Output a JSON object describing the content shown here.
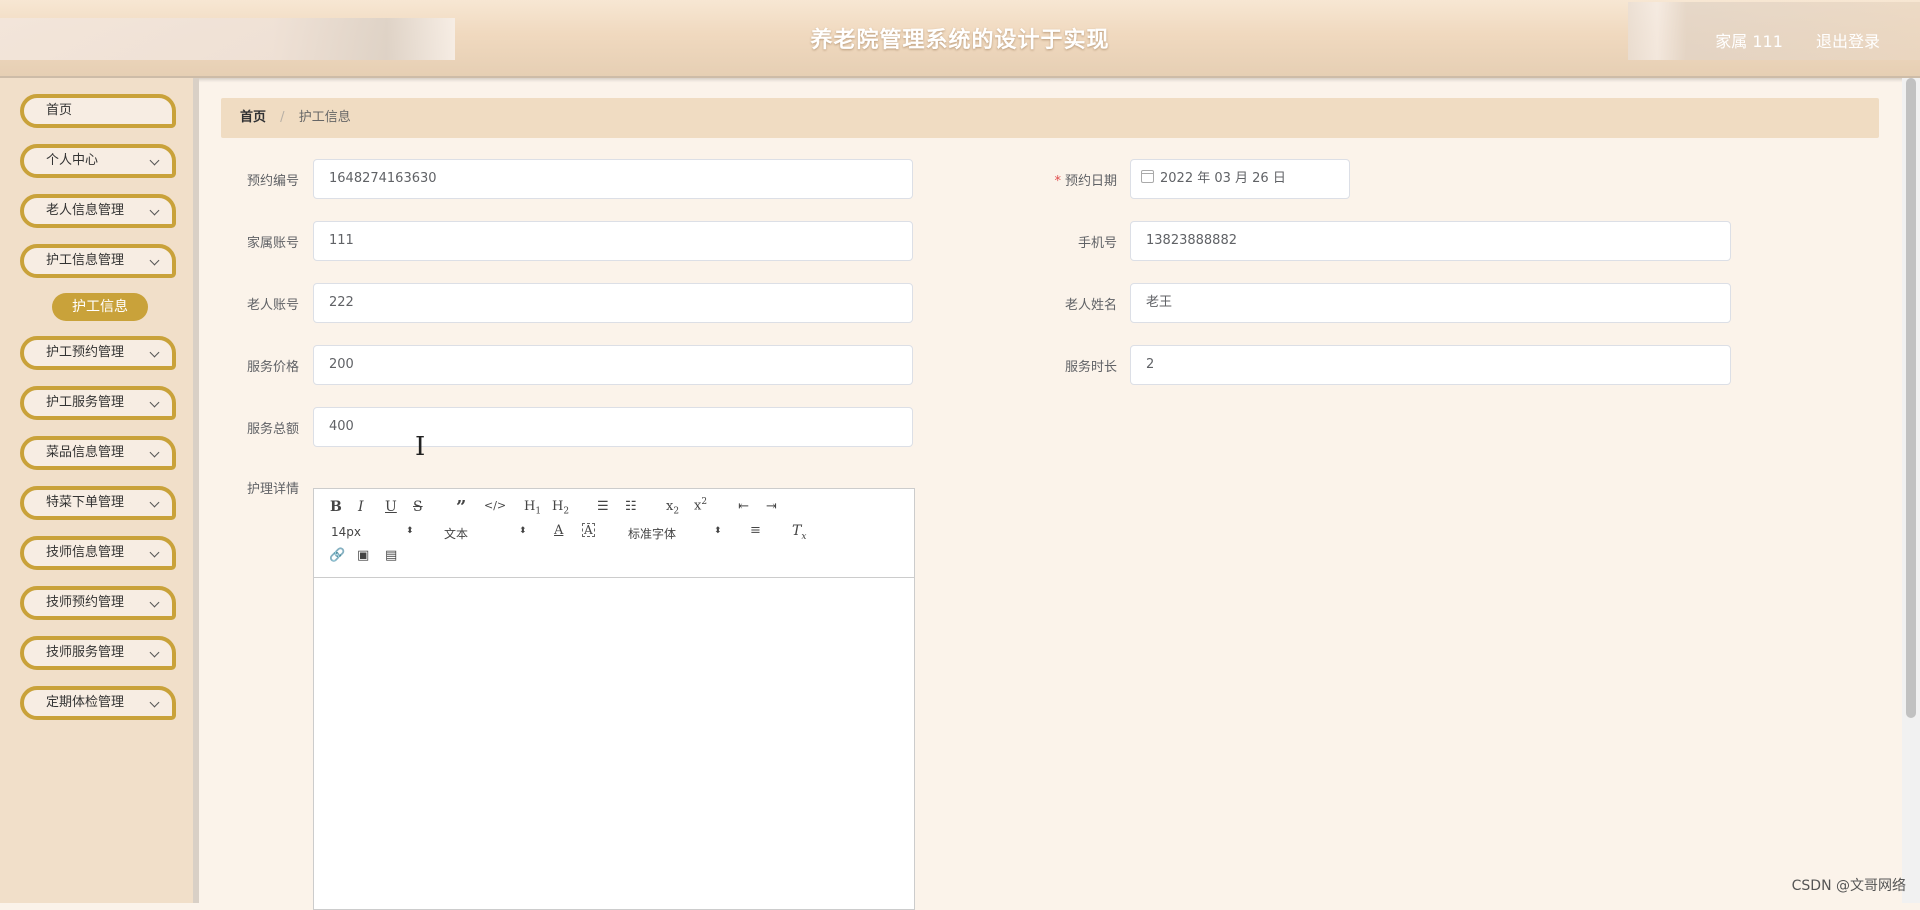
{
  "header": {
    "title": "养老院管理系统的设计于实现",
    "user": "家属 111",
    "logout": "退出登录"
  },
  "sidebar": {
    "items": [
      {
        "label": "首页",
        "has_chevron": false
      },
      {
        "label": "个人中心",
        "has_chevron": true
      },
      {
        "label": "老人信息管理",
        "has_chevron": true
      },
      {
        "label": "护工信息管理",
        "has_chevron": true
      },
      {
        "label": "护工预约管理",
        "has_chevron": true
      },
      {
        "label": "护工服务管理",
        "has_chevron": true
      },
      {
        "label": "菜品信息管理",
        "has_chevron": true
      },
      {
        "label": "特菜下单管理",
        "has_chevron": true
      },
      {
        "label": "技师信息管理",
        "has_chevron": true
      },
      {
        "label": "技师预约管理",
        "has_chevron": true
      },
      {
        "label": "技师服务管理",
        "has_chevron": true
      },
      {
        "label": "定期体检管理",
        "has_chevron": true
      }
    ],
    "sub_item": "护工信息"
  },
  "breadcrumb": {
    "home": "首页",
    "separator": "/",
    "current": "护工信息"
  },
  "form": {
    "booking_no_label": "预约编号",
    "booking_no_value": "1648274163630",
    "booking_date_label": "预约日期",
    "booking_date_required": "*",
    "booking_date_value": "2022 年 03 月 26 日",
    "family_account_label": "家属账号",
    "family_account_value": "111",
    "phone_label": "手机号",
    "phone_value": "13823888882",
    "elder_account_label": "老人账号",
    "elder_account_value": "222",
    "elder_name_label": "老人姓名",
    "elder_name_value": "老王",
    "price_label": "服务价格",
    "price_value": "200",
    "duration_label": "服务时长",
    "duration_value": "2",
    "total_label": "服务总额",
    "total_value": "400",
    "details_label": "护理详情"
  },
  "editor": {
    "font_size": "14px",
    "block_type": "文本",
    "font_family": "标准字体",
    "buttons": [
      "bold-icon",
      "italic-icon",
      "underline-icon",
      "strikethrough-icon",
      "blockquote-icon",
      "code-icon",
      "h1-icon",
      "h2-icon",
      "ordered-list-icon",
      "bullet-list-icon",
      "subscript-icon",
      "superscript-icon",
      "outdent-icon",
      "indent-icon",
      "font-color-icon",
      "background-color-icon",
      "align-icon",
      "clear-format-icon",
      "link-icon",
      "image-icon",
      "video-icon"
    ]
  },
  "colors": {
    "accent": "#c9a23a",
    "breadcrumb_bg": "#f0dcc2",
    "sidebar_bg": "#f1dfc9"
  },
  "watermark": "CSDN @文哥网络"
}
